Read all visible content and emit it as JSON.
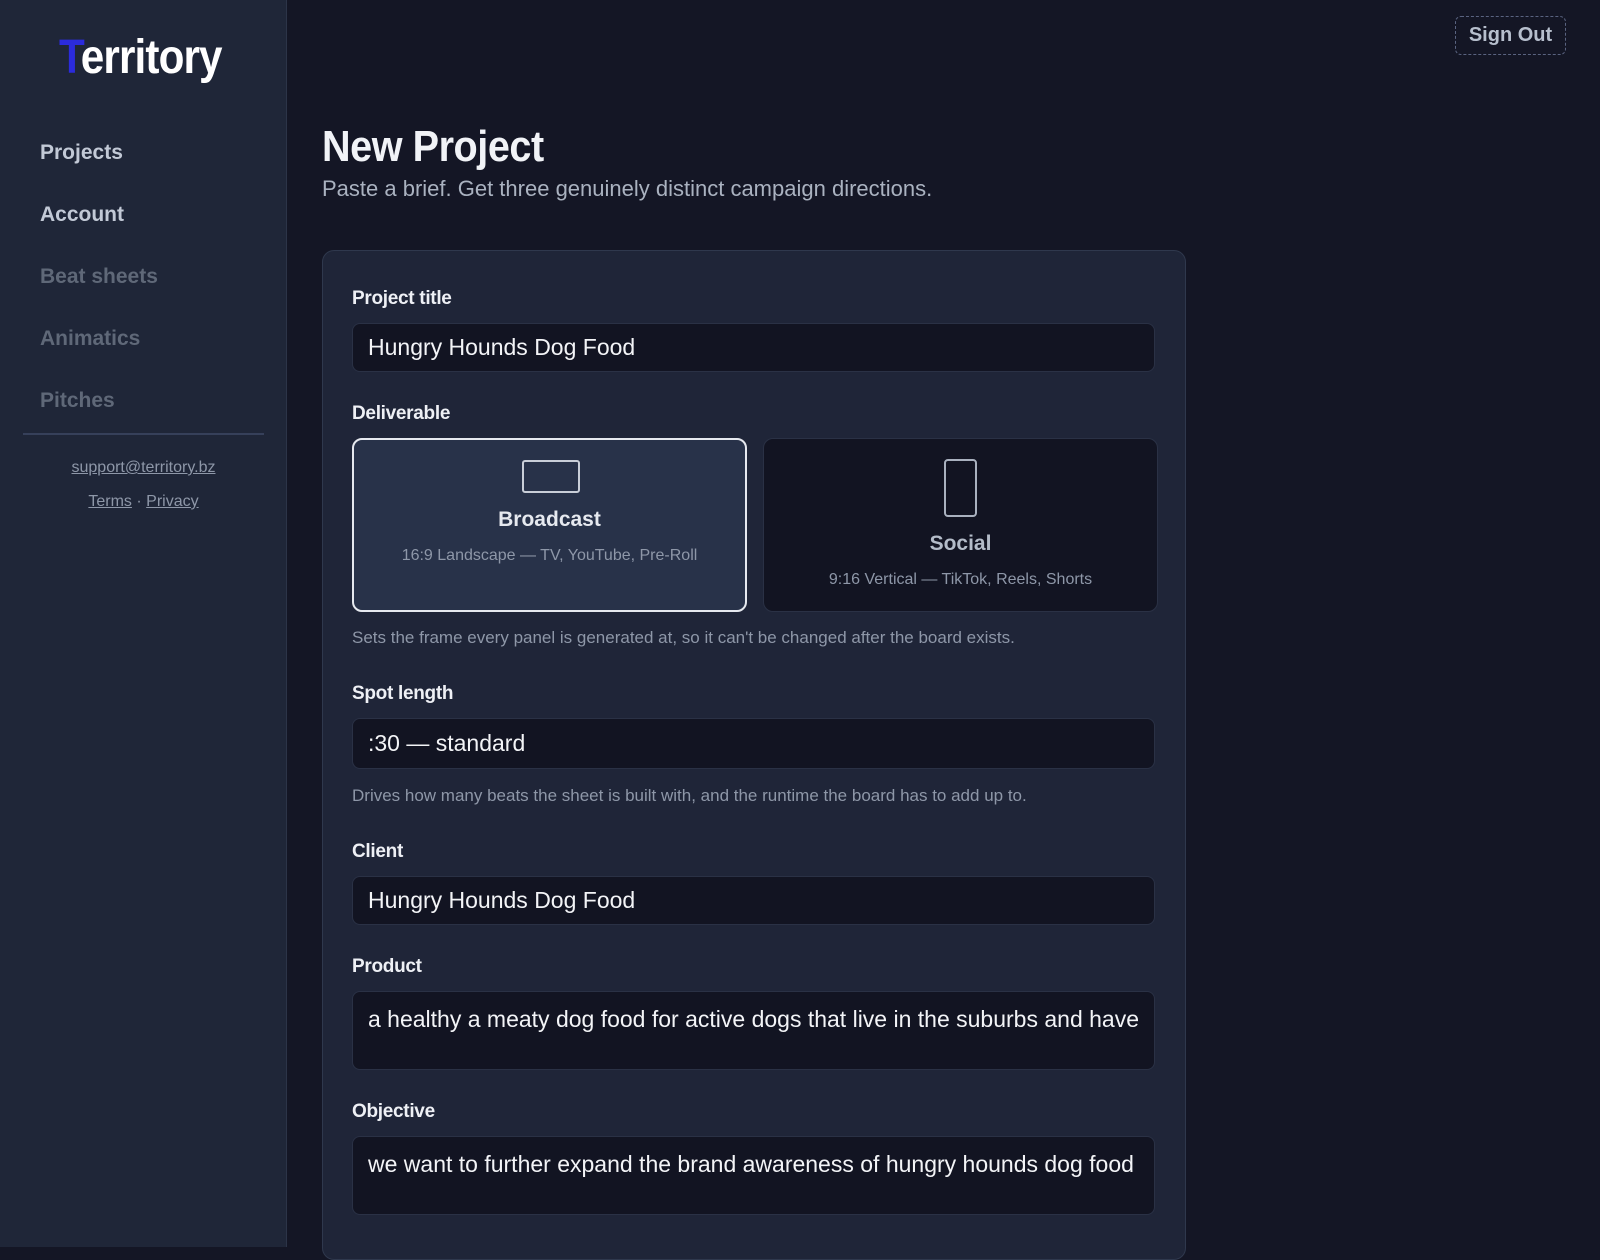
{
  "app": {
    "logo_first_letter": "T",
    "logo_rest": "erritory"
  },
  "sidebar": {
    "items": [
      {
        "label": "Projects",
        "state": "enabled"
      },
      {
        "label": "Account",
        "state": "enabled"
      },
      {
        "label": "Beat sheets",
        "state": "disabled"
      },
      {
        "label": "Animatics",
        "state": "disabled"
      },
      {
        "label": "Pitches",
        "state": "disabled"
      }
    ],
    "support_email": "support@territory.bz",
    "terms_label": "Terms",
    "separator": "·",
    "privacy_label": "Privacy"
  },
  "header": {
    "sign_out_label": "Sign Out"
  },
  "page": {
    "title": "New Project",
    "subtitle": "Paste a brief. Get three genuinely distinct campaign directions."
  },
  "form": {
    "project_title": {
      "label": "Project title",
      "value": "Hungry Hounds Dog Food"
    },
    "deliverable": {
      "label": "Deliverable",
      "options": [
        {
          "title": "Broadcast",
          "description": "16:9 Landscape — TV, YouTube, Pre-Roll",
          "icon": "landscape-frame-icon",
          "selected": true
        },
        {
          "title": "Social",
          "description": "9:16 Vertical — TikTok, Reels, Shorts",
          "icon": "portrait-frame-icon",
          "selected": false
        }
      ],
      "hint": "Sets the frame every panel is generated at, so it can't be changed after the board exists."
    },
    "spot_length": {
      "label": "Spot length",
      "value": ":30 — standard",
      "hint": "Drives how many beats the sheet is built with, and the runtime the board has to add up to."
    },
    "client": {
      "label": "Client",
      "value": "Hungry Hounds Dog Food"
    },
    "product": {
      "label": "Product",
      "value": "a healthy a meaty dog food for active dogs that live in the suburbs and have"
    },
    "objective": {
      "label": "Objective",
      "value": "we want to further expand the brand awareness of hungry hounds dog food"
    }
  },
  "colors": {
    "background": "#141625",
    "sidebar": "#1f2638",
    "card": "#1f2538",
    "input": "#121422",
    "logo_accent": "#2b2bdc"
  }
}
